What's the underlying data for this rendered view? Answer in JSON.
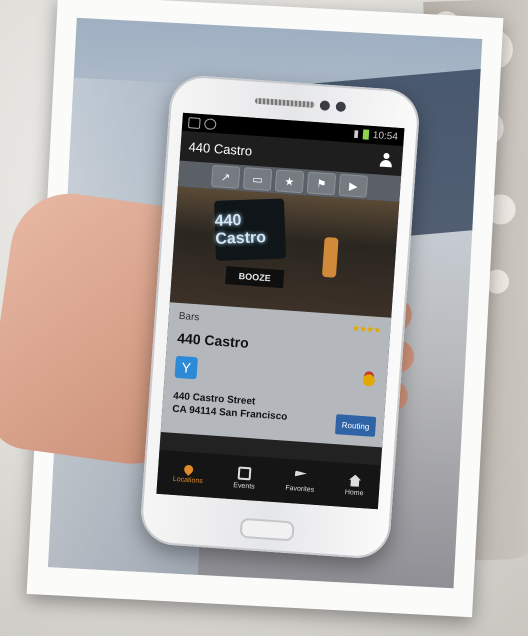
{
  "status_bar": {
    "time": "10:54"
  },
  "action_bar": {
    "title": "440 Castro"
  },
  "toolbar": {
    "buttons": [
      "share-icon",
      "chat-icon",
      "star-icon",
      "flag-icon",
      "play-icon"
    ]
  },
  "venue_photo": {
    "sign_text": "440 Castro",
    "booze_sign": "BOOZE"
  },
  "detail": {
    "category": "Bars",
    "name": "440 Castro",
    "address_line1": "440 Castro Street",
    "address_line2": "CA 94114 San Francisco",
    "routing_label": "Routing"
  },
  "tabs": [
    {
      "label": "Locations",
      "icon": "pin-icon",
      "active": true
    },
    {
      "label": "Events",
      "icon": "calendar-icon",
      "active": false
    },
    {
      "label": "Favorites",
      "icon": "flag-icon",
      "active": false
    },
    {
      "label": "Home",
      "icon": "home-icon",
      "active": false
    }
  ],
  "colors": {
    "accent": "#e08a2a",
    "routing": "#2f63a8",
    "cocktail": "#2c8ad6"
  }
}
